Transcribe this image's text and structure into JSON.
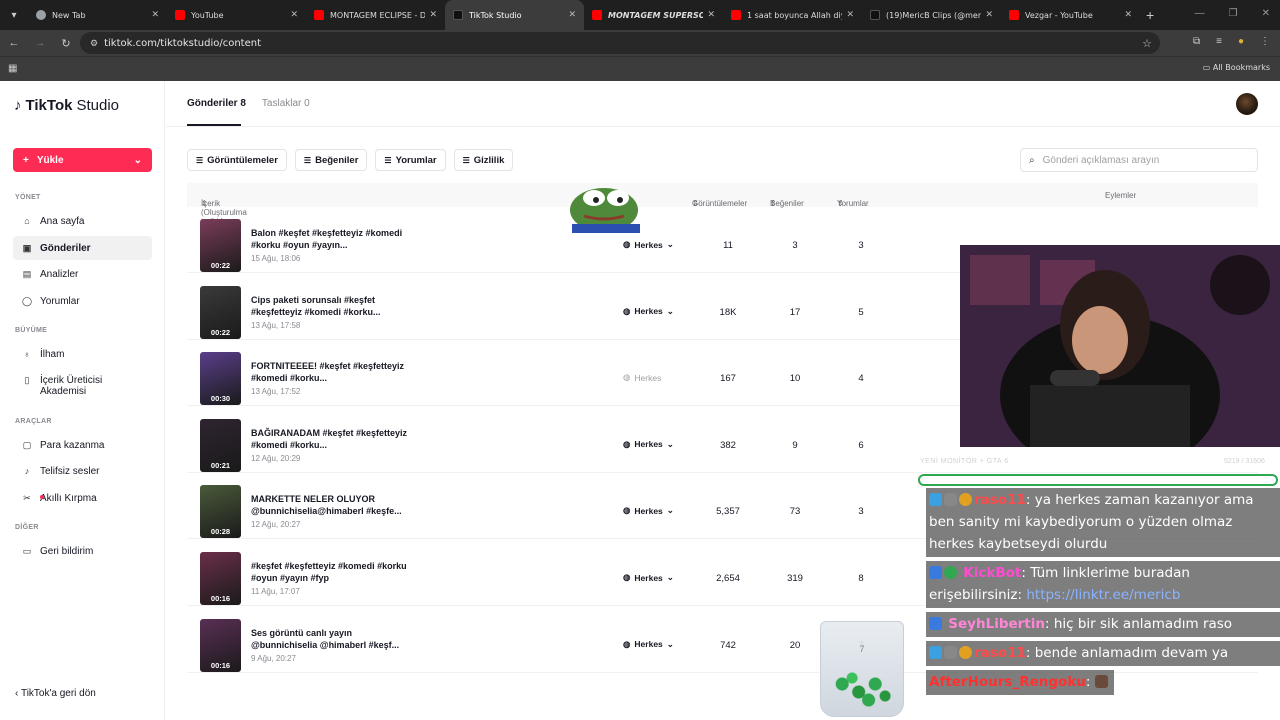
{
  "browser": {
    "tabs": [
      {
        "title": "New Tab",
        "favicon_color": "#9aa0a6"
      },
      {
        "title": "YouTube",
        "favicon_color": "#ff0000"
      },
      {
        "title": "MONTAGEM ECLIPSE - D...",
        "favicon_color": "#ff0000"
      },
      {
        "title": "TikTok Studio",
        "favicon_color": "#111111"
      },
      {
        "title": "MONTAGEM SUPERSONI...",
        "favicon_color": "#ff0000"
      },
      {
        "title": "1 saat boyunca Allah diye...",
        "favicon_color": "#ff0000"
      },
      {
        "title": "(19)MericB Clips (@meric...",
        "favicon_color": "#111111"
      },
      {
        "title": "Vezgar - YouTube",
        "favicon_color": "#ff0000"
      }
    ],
    "url": "tiktok.com/tiktokstudio/content",
    "all_bookmarks": "All Bookmarks"
  },
  "sidebar": {
    "logo_tiktok": "TikTok",
    "logo_studio": "Studio",
    "upload_label": "Yükle",
    "sections": {
      "manage": "YÖNET",
      "growth": "BÜYÜME",
      "tools": "ARAÇLAR",
      "other": "DİĞER"
    },
    "items": {
      "home": "Ana sayfa",
      "posts": "Gönderiler",
      "analytics": "Analizler",
      "comments": "Yorumlar",
      "inspiration": "İlham",
      "academy": "İçerik Üreticisi Akademisi",
      "monetize": "Para kazanma",
      "free_sounds": "Telifsiz sesler",
      "smart_cut": "Akıllı Kırpma",
      "feedback": "Geri bildirim"
    },
    "back": "TikTok'a geri dön"
  },
  "main": {
    "tab_posts": "Gönderiler 8",
    "tab_drafts": "Taslaklar 0",
    "filters": [
      "Görüntülemeler",
      "Beğeniler",
      "Yorumlar",
      "Gizlilik"
    ],
    "search_placeholder": "Gönderi açıklaması arayın",
    "columns": {
      "content": "İçerik (Oluşturulma tarihi:)",
      "views": "Görüntülemeler",
      "likes": "Beğeniler",
      "comments": "Yorumlar",
      "actions": "Eylemler"
    },
    "rows": [
      {
        "title": "Balon #keşfet #keşfetteyiz #komedi #korku #oyun #yayın...",
        "date": "15 Ağu, 18:06",
        "duration": "00:22",
        "privacy": "Herkes",
        "views": "11",
        "likes": "3",
        "comments": "3",
        "thumb": "#7a3d5a"
      },
      {
        "title": "Cips paketi sorunsalı #keşfet #keşfetteyiz #komedi #korku...",
        "date": "13 Ağu, 17:58",
        "duration": "00:22",
        "privacy": "Herkes",
        "views": "18K",
        "likes": "17",
        "comments": "5",
        "thumb": "#3a3a3a"
      },
      {
        "title": "FORTNITEEEE! #keşfet #keşfetteyiz #komedi #korku...",
        "date": "13 Ağu, 17:52",
        "duration": "00:30",
        "privacy": "Herkes",
        "views": "167",
        "likes": "10",
        "comments": "4",
        "thumb": "#5a3f8a"
      },
      {
        "title": "BAĞIRANADAM #keşfet #keşfetteyiz #komedi #korku...",
        "date": "12 Ağu, 20:29",
        "duration": "00:21",
        "privacy": "Herkes",
        "views": "382",
        "likes": "9",
        "comments": "6",
        "thumb": "#2e2430"
      },
      {
        "title": "MARKETTE NELER OLUYOR @bunnichiselia@himaberl #keşfe...",
        "date": "12 Ağu, 20:27",
        "duration": "00:28",
        "privacy": "Herkes",
        "views": "5,357",
        "likes": "73",
        "comments": "3",
        "thumb": "#4a5a3a"
      },
      {
        "title": "#keşfet #keşfetteyiz #komedi #korku #oyun #yayın #fyp",
        "date": "11 Ağu, 17:07",
        "duration": "00:16",
        "privacy": "Herkes",
        "views": "2,654",
        "likes": "319",
        "comments": "8",
        "thumb": "#6a2f4a"
      },
      {
        "title": "Ses görüntü canlı yayın @bunnichiselia @himaberl #keşf...",
        "date": "9 Ağu, 20:27",
        "duration": "00:16",
        "privacy": "Herkes",
        "views": "742",
        "likes": "20",
        "comments": "7",
        "thumb": "#5a2f55"
      }
    ]
  },
  "overlay": {
    "cam_label": "YENİ MONİTÖR + GTA 6",
    "cam_count": "5219 / 31606",
    "chat": [
      {
        "user": "raso11",
        "text": ": ya herkes zaman kazanıyor ama ben sanity mi kaybediyorum o yüzden olmaz herkes kaybetseydi olurdu"
      },
      {
        "user": "KickBot",
        "text": ": Tüm linklerime buradan erişebilirsiniz: ",
        "link": "https://linktr.ee/mericb"
      },
      {
        "user": "SeyhLibertin",
        "text": ": hiç bir sik anlamadım raso"
      },
      {
        "user": "raso11",
        "text": ": bende anlamadım devam ya"
      },
      {
        "user": "AfterHours_Rengoku",
        "text": ":"
      }
    ],
    "jar_label": "7"
  }
}
